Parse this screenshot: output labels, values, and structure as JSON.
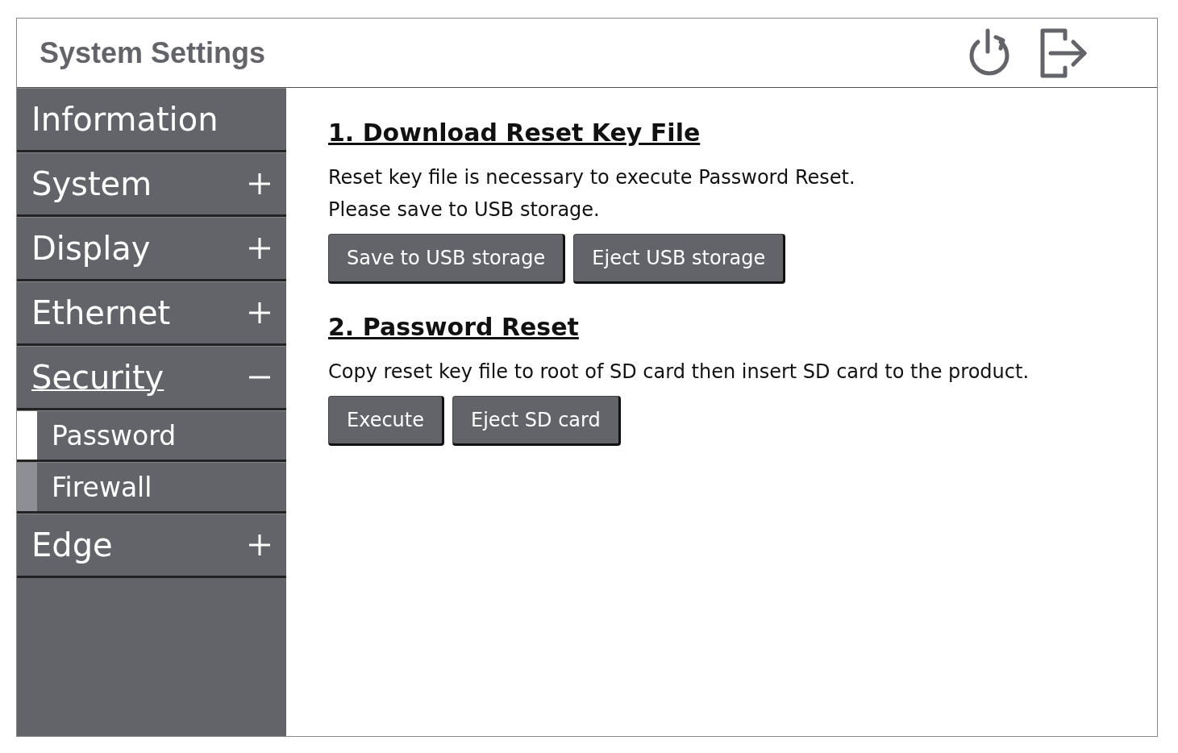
{
  "window": {
    "title": "System Settings"
  },
  "sidebar": {
    "items": [
      {
        "kind": "item",
        "label": "Information",
        "selected": false
      },
      {
        "kind": "group",
        "label": "System",
        "selected": false,
        "expanded": false
      },
      {
        "kind": "group",
        "label": "Display",
        "selected": false,
        "expanded": false
      },
      {
        "kind": "group",
        "label": "Ethernet",
        "selected": false,
        "expanded": false
      },
      {
        "kind": "group",
        "label": "Security",
        "selected": true,
        "expanded": true,
        "children": [
          {
            "label": "Password",
            "selected": true
          },
          {
            "label": "Firewall",
            "selected": false
          }
        ]
      },
      {
        "kind": "group",
        "label": "Edge",
        "selected": false,
        "expanded": false
      }
    ]
  },
  "sections": [
    {
      "title": "1. Download Reset Key File",
      "lines": [
        "Reset key file is necessary to execute Password Reset.",
        "Please save to USB storage."
      ],
      "buttons": [
        "Save to USB storage",
        "Eject USB storage"
      ]
    },
    {
      "title": "2. Password Reset",
      "lines": [
        "Copy reset key file to root of SD card then insert SD card to the product."
      ],
      "buttons": [
        "Execute",
        "Eject SD card"
      ]
    }
  ]
}
